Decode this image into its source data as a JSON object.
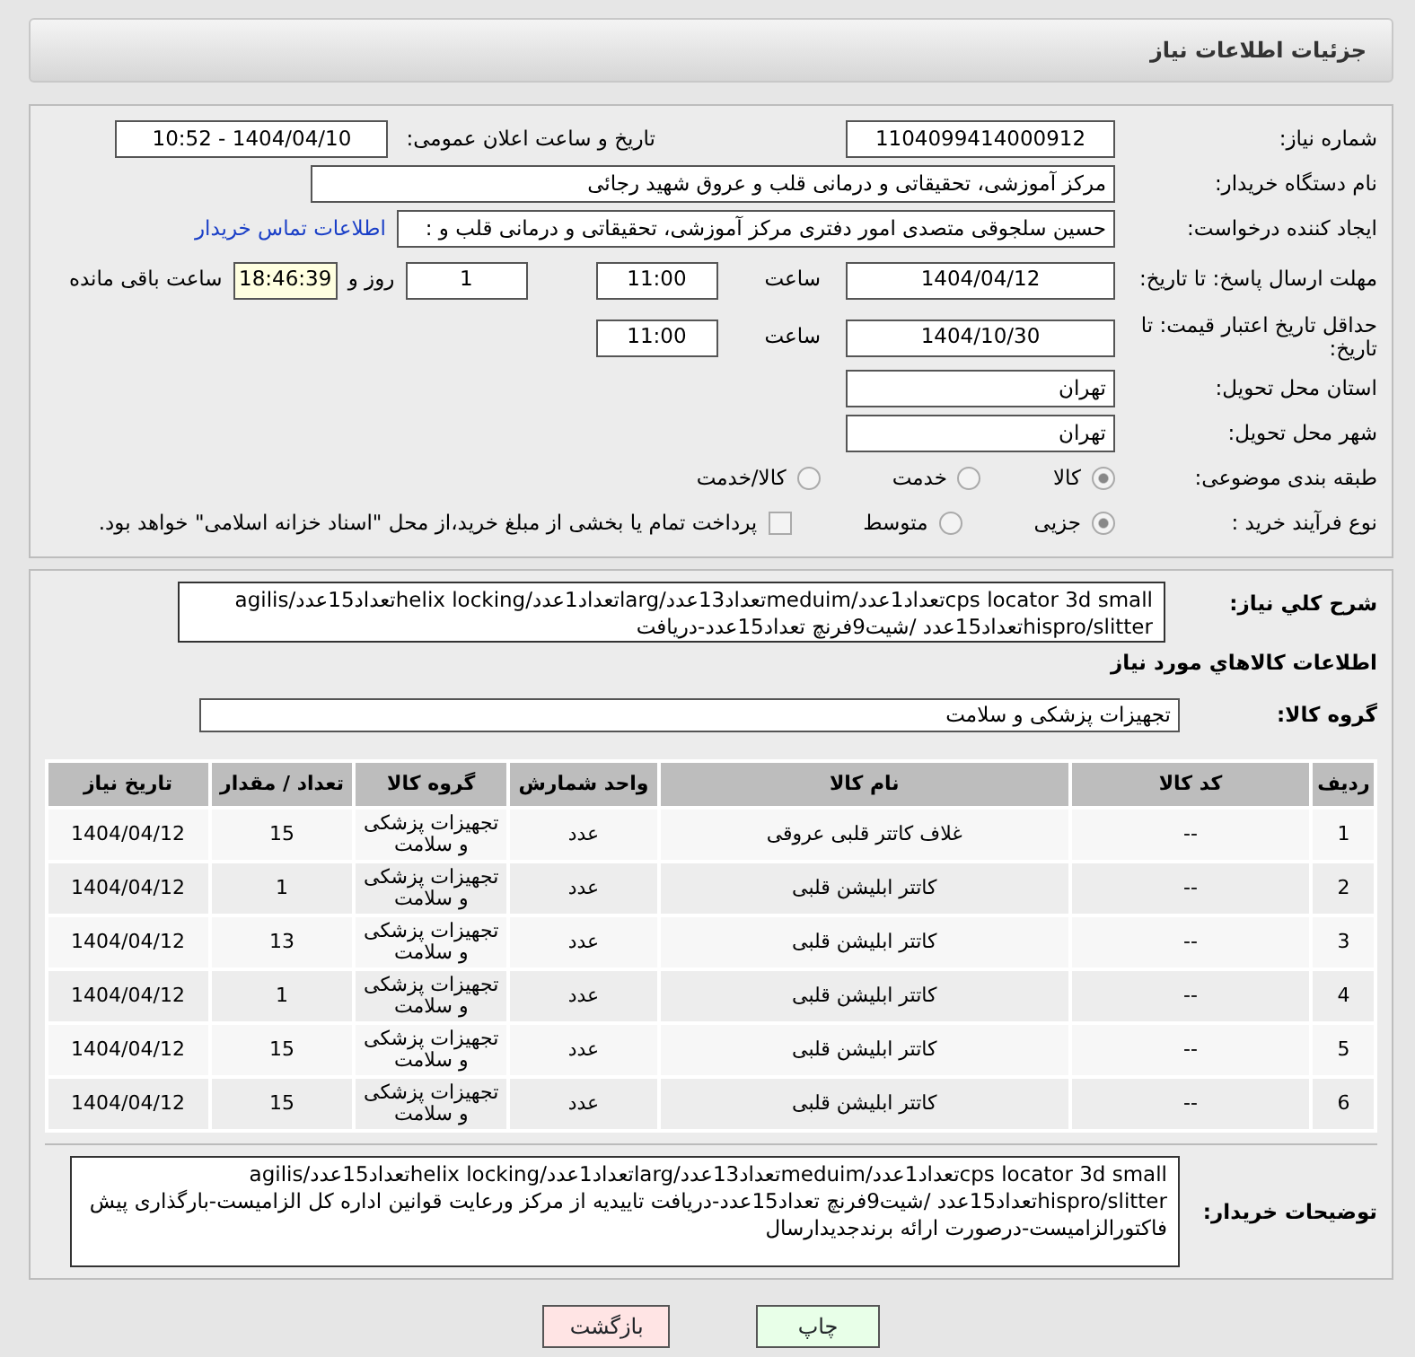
{
  "header": {
    "title": "جزئیات اطلاعات نیاز"
  },
  "need_number": {
    "label": "شماره نیاز:",
    "value": "1104099414000912"
  },
  "announce": {
    "label": "تاریخ و ساعت اعلان عمومی:",
    "value": "1404/04/10 - 10:52"
  },
  "buyer_org": {
    "label": "نام دستگاه خریدار:",
    "value": "مرکز آموزشی، تحقیقاتی و درمانی قلب و عروق شهید رجائی"
  },
  "creator": {
    "label": "ایجاد کننده درخواست:",
    "value": "حسین سلجوقی متصدی امور دفتری مرکز آموزشی، تحقیقاتی و درمانی قلب و :",
    "link": "اطلاعات تماس خریدار"
  },
  "deadline": {
    "label": "مهلت ارسال پاسخ: تا تاریخ:",
    "date": "1404/04/12",
    "time_label": "ساعت",
    "time": "11:00",
    "days": "1",
    "days_label": "روز و",
    "remaining": "18:46:39",
    "remaining_label": "ساعت باقی مانده"
  },
  "validity": {
    "label": "حداقل تاریخ اعتبار قیمت: تا تاریخ:",
    "date": "1404/10/30",
    "time_label": "ساعت",
    "time": "11:00"
  },
  "province": {
    "label": "استان محل تحویل:",
    "value": "تهران"
  },
  "city": {
    "label": "شهر محل تحویل:",
    "value": "تهران"
  },
  "category": {
    "label": "طبقه بندی موضوعی:",
    "options": [
      {
        "label": "کالا",
        "selected": true
      },
      {
        "label": "خدمت",
        "selected": false
      },
      {
        "label": "کالا/خدمت",
        "selected": false
      }
    ]
  },
  "process": {
    "label": "نوع فرآیند خرید :",
    "options": [
      {
        "label": "جزیی",
        "selected": true
      },
      {
        "label": "متوسط",
        "selected": false
      }
    ],
    "payment": {
      "label": "پرداخت تمام یا بخشی از مبلغ خرید،از محل \"اسناد خزانه اسلامی\" خواهد بود.",
      "checked": false
    }
  },
  "description": {
    "label": "شرح کلي نياز:",
    "value": "cps locator 3d smallتعداد1عدد/meduimتعداد13عدد/largتعداد1عدد/helix lockingتعداد15عدد/agilis hispro/slitterتعداد15عدد /شیت9فرنچ تعداد15عدد-دریافت"
  },
  "items_title": "اطلاعات كالاهاي مورد نياز",
  "goods_group": {
    "label": "گروه کالا:",
    "value": "تجهیزات پزشکی و سلامت"
  },
  "table": {
    "columns": [
      "ردیف",
      "کد کالا",
      "نام کالا",
      "واحد شمارش",
      "گروه کالا",
      "تعداد / مقدار",
      "تاریخ نیاز"
    ],
    "rows": [
      [
        "1",
        "--",
        "غلاف کاتتر قلبی عروقی",
        "عدد",
        "تجهیزات پزشکی و سلامت",
        "15",
        "1404/04/12"
      ],
      [
        "2",
        "--",
        "کاتتر ابلیشن قلبی",
        "عدد",
        "تجهیزات پزشکی و سلامت",
        "1",
        "1404/04/12"
      ],
      [
        "3",
        "--",
        "کاتتر ابلیشن قلبی",
        "عدد",
        "تجهیزات پزشکی و سلامت",
        "13",
        "1404/04/12"
      ],
      [
        "4",
        "--",
        "کاتتر ابلیشن قلبی",
        "عدد",
        "تجهیزات پزشکی و سلامت",
        "1",
        "1404/04/12"
      ],
      [
        "5",
        "--",
        "کاتتر ابلیشن قلبی",
        "عدد",
        "تجهیزات پزشکی و سلامت",
        "15",
        "1404/04/12"
      ],
      [
        "6",
        "--",
        "کاتتر ابلیشن قلبی",
        "عدد",
        "تجهیزات پزشکی و سلامت",
        "15",
        "1404/04/12"
      ]
    ]
  },
  "buyer_notes": {
    "label": "توضیحات خریدار:",
    "value": "cps locator 3d smallتعداد1عدد/meduimتعداد13عدد/largتعداد1عدد/helix lockingتعداد15عدد/agilis hispro/slitterتعداد15عدد /شیت9فرنچ تعداد15عدد-دریافت تاییدیه از مرکز ورعایت قوانین اداره کل الزامیست-بارگذاری پیش فاکتورالزامیست-درصورت ارائه برندجدیدارسال"
  },
  "buttons": [
    {
      "label": "چاپ",
      "kind": "print"
    },
    {
      "label": "بازگشت",
      "kind": "back"
    }
  ]
}
